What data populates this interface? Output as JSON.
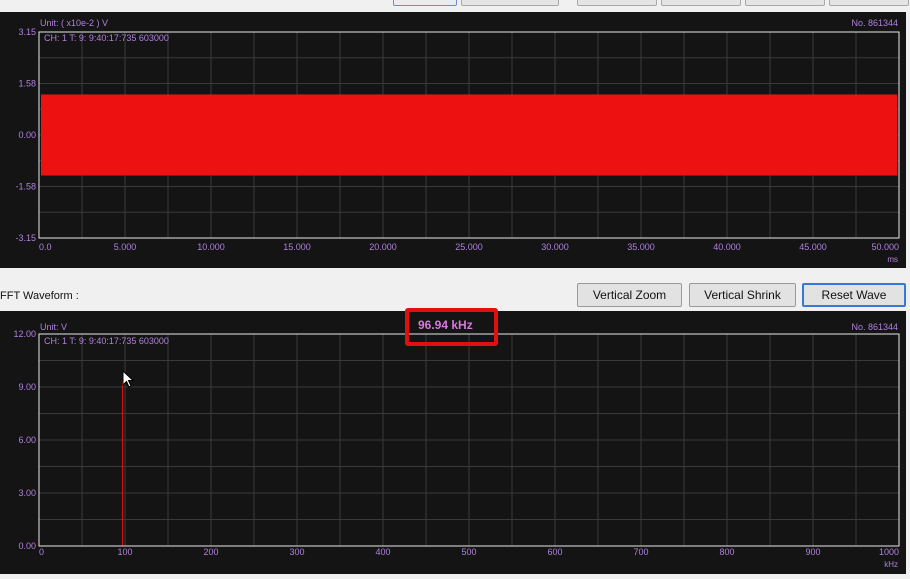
{
  "top_panel": {
    "unit_label": "Unit: ( x10e-2 ) V",
    "id_label": "No. 861344",
    "channel_info": "CH: 1  T: 9: 9:40:17:735 603000",
    "y_ticks": [
      "3.15",
      "1.58",
      "0.00",
      "-1.58",
      "-3.15"
    ],
    "x_ticks": [
      "0.0",
      "5.000",
      "10.000",
      "15.000",
      "20.000",
      "25.000",
      "30.000",
      "35.000",
      "40.000",
      "45.000",
      "50.000"
    ],
    "x_unit": "ms",
    "signal_color": "#ee1111"
  },
  "fft_label": "FFT Waveform :",
  "buttons": {
    "vertical_zoom": "Vertical Zoom",
    "vertical_shrink": "Vertical Shrink",
    "reset_wave": "Reset Wave"
  },
  "bottom_panel": {
    "unit_label": "Unit: V",
    "id_label": "No. 861344",
    "channel_info": "CH: 1  T: 9: 9:40:17:735 603000",
    "peak_frequency": "96.94 kHz",
    "y_ticks": [
      "12.00",
      "9.00",
      "6.00",
      "3.00",
      "0.00"
    ],
    "x_ticks": [
      "0",
      "100",
      "200",
      "300",
      "400",
      "500",
      "600",
      "700",
      "800",
      "900",
      "1000"
    ],
    "x_unit": "kHz"
  },
  "colors": {
    "plot_bg": "#141414",
    "grid": "#3a3a3a",
    "axis_text": "#b080e0",
    "frame": "#e8e8e8",
    "signal": "#ee1111",
    "highlight": "#e01010"
  },
  "chart_data": [
    {
      "type": "area",
      "xlabel": "",
      "x_unit": "ms",
      "ylabel": "",
      "xlim": [
        0,
        50
      ],
      "ylim": [
        -3.15,
        3.15
      ],
      "series": [
        {
          "name": "",
          "x": [
            0,
            50
          ],
          "upper": [
            1.24,
            1.24
          ],
          "lower": [
            -1.24,
            -1.24
          ]
        }
      ]
    },
    {
      "type": "bar",
      "xlabel": "",
      "x_unit": "kHz",
      "ylabel": "",
      "xlim": [
        0,
        1000
      ],
      "ylim": [
        0,
        12
      ],
      "series": [
        {
          "name": "",
          "x": [
            96.94
          ],
          "values": [
            9.3
          ]
        }
      ],
      "annotation": "96.94 kHz"
    }
  ]
}
